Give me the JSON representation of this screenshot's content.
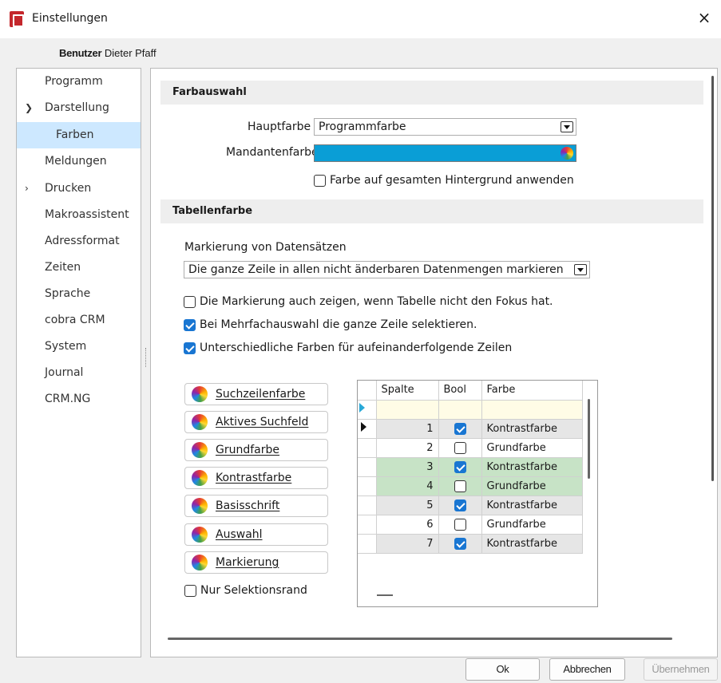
{
  "window": {
    "title": "Einstellungen",
    "close": "×"
  },
  "user": {
    "label": "Benutzer",
    "name": "Dieter Pfaff"
  },
  "nav": {
    "items": [
      {
        "label": "Programm"
      },
      {
        "label": "Darstellung",
        "expander": "expanded"
      },
      {
        "label": "Farben",
        "selected": true
      },
      {
        "label": "Meldungen"
      },
      {
        "label": "Drucken",
        "expander": "collapsed"
      },
      {
        "label": "Makroassistent"
      },
      {
        "label": "Adressformat"
      },
      {
        "label": "Zeiten"
      },
      {
        "label": "Sprache"
      },
      {
        "label": "cobra CRM"
      },
      {
        "label": "System"
      },
      {
        "label": "Journal"
      },
      {
        "label": "CRM.NG"
      }
    ]
  },
  "farbauswahl": {
    "header": "Farbauswahl",
    "hauptfarbe_label": "Hauptfarbe",
    "hauptfarbe_value": "Programmfarbe",
    "mandantenfarbe_label": "Mandantenfarbe",
    "mandantenfarbe_color": "#0a9ed6",
    "hintergrund_label": "Farbe auf gesamten Hintergrund anwenden",
    "hintergrund_checked": false
  },
  "tabellenfarbe": {
    "header": "Tabellenfarbe",
    "markierung_label": "Markierung von Datensätzen",
    "markierung_value": "Die ganze Zeile in allen nicht änderbaren Datenmengen markieren",
    "opt_fokus": "Die Markierung auch zeigen, wenn Tabelle nicht den Fokus hat.",
    "opt_fokus_checked": false,
    "opt_mehrfach": "Bei Mehrfachauswahl die ganze Zeile selektieren.",
    "opt_mehrfach_checked": true,
    "opt_farben": "Unterschiedliche Farben für aufeinanderfolgende Zeilen",
    "opt_farben_checked": true
  },
  "color_buttons": [
    "Suchzeilenfarbe",
    "Aktives Suchfeld",
    "Grundfarbe",
    "Kontrastfarbe",
    "Basisschrift",
    "Auswahl",
    "Markierung"
  ],
  "nur_selektionsrand": {
    "label": "Nur Selektionsrand",
    "checked": false
  },
  "grid": {
    "columns": [
      "Spalte",
      "Bool",
      "Farbe"
    ],
    "rows": [
      {
        "n": "1",
        "b": true,
        "f": "Kontrastfarbe",
        "style": "grey",
        "current": true
      },
      {
        "n": "2",
        "b": false,
        "f": "Grundfarbe",
        "style": "white"
      },
      {
        "n": "3",
        "b": true,
        "f": "Kontrastfarbe",
        "style": "green"
      },
      {
        "n": "4",
        "b": false,
        "f": "Grundfarbe",
        "style": "green"
      },
      {
        "n": "5",
        "b": true,
        "f": "Kontrastfarbe",
        "style": "grey"
      },
      {
        "n": "6",
        "b": false,
        "f": "Grundfarbe",
        "style": "white"
      },
      {
        "n": "7",
        "b": true,
        "f": "Kontrastfarbe",
        "style": "grey"
      }
    ]
  },
  "footer": {
    "ok": "Ok",
    "cancel": "Abbrechen",
    "apply": "Übernehmen"
  }
}
